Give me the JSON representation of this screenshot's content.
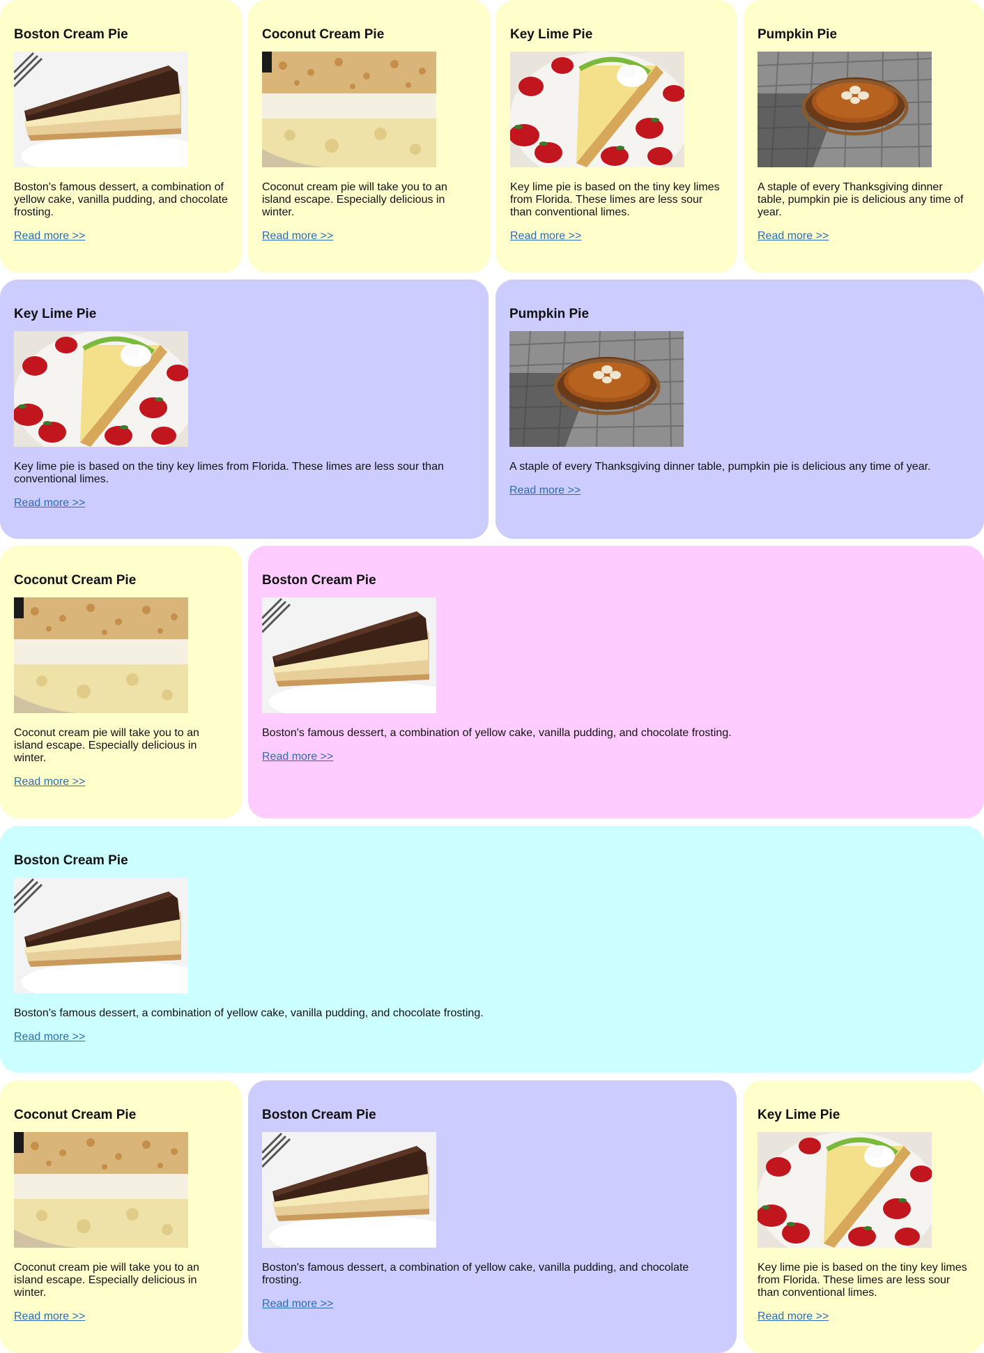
{
  "cards": [
    {
      "title": "Boston Cream Pie",
      "image": "boston-cream-pie-photo",
      "text": "Boston's famous dessert, a combination of yellow cake, vanilla pudding, and chocolate frosting.",
      "link": "Read more >>"
    },
    {
      "title": "Coconut Cream Pie",
      "image": "coconut-cream-pie-photo",
      "text": "Coconut cream pie will take you to an island escape. Especially delicious in winter.",
      "link": "Read more >>"
    },
    {
      "title": "Key Lime Pie",
      "image": "key-lime-pie-photo",
      "text": "Key lime pie is based on the tiny key limes from Florida. These limes are less sour than conventional limes.",
      "link": "Read more >>"
    },
    {
      "title": "Pumpkin Pie",
      "image": "pumpkin-pie-photo",
      "text": "A staple of every Thanksgiving dinner table, pumpkin pie is delicious any time of year.",
      "link": "Read more >>"
    },
    {
      "title": "Key Lime Pie",
      "image": "key-lime-pie-photo",
      "text": "Key lime pie is based on the tiny key limes from Florida. These limes are less sour than conventional limes.",
      "link": "Read more >>"
    },
    {
      "title": "Pumpkin Pie",
      "image": "pumpkin-pie-photo",
      "text": "A staple of every Thanksgiving dinner table, pumpkin pie is delicious any time of year.",
      "link": "Read more >>"
    },
    {
      "title": "Coconut Cream Pie",
      "image": "coconut-cream-pie-photo",
      "text": "Coconut cream pie will take you to an island escape. Especially delicious in winter.",
      "link": "Read more >>"
    },
    {
      "title": "Boston Cream Pie",
      "image": "boston-cream-pie-photo",
      "text": "Boston's famous dessert, a combination of yellow cake, vanilla pudding, and chocolate frosting.",
      "link": "Read more >>"
    },
    {
      "title": "Boston Cream Pie",
      "image": "boston-cream-pie-photo",
      "text": "Boston's famous dessert, a combination of yellow cake, vanilla pudding, and chocolate frosting.",
      "link": "Read more >>"
    },
    {
      "title": "Coconut Cream Pie",
      "image": "coconut-cream-pie-photo",
      "text": "Coconut cream pie will take you to an island escape. Especially delicious in winter.",
      "link": "Read more >>"
    },
    {
      "title": "Boston Cream Pie",
      "image": "boston-cream-pie-photo",
      "text": "Boston's famous dessert, a combination of yellow cake, vanilla pudding, and chocolate frosting.",
      "link": "Read more >>"
    },
    {
      "title": "Key Lime Pie",
      "image": "key-lime-pie-photo",
      "text": "Key lime pie is based on the tiny key limes from Florida. These limes are less sour than conventional limes.",
      "link": "Read more >>"
    }
  ],
  "colors": {
    "yellow": "#ffffcc",
    "lavender": "#ccccff",
    "pink": "#ffccff",
    "cyan": "#ccffff",
    "link": "#2a6db5"
  }
}
